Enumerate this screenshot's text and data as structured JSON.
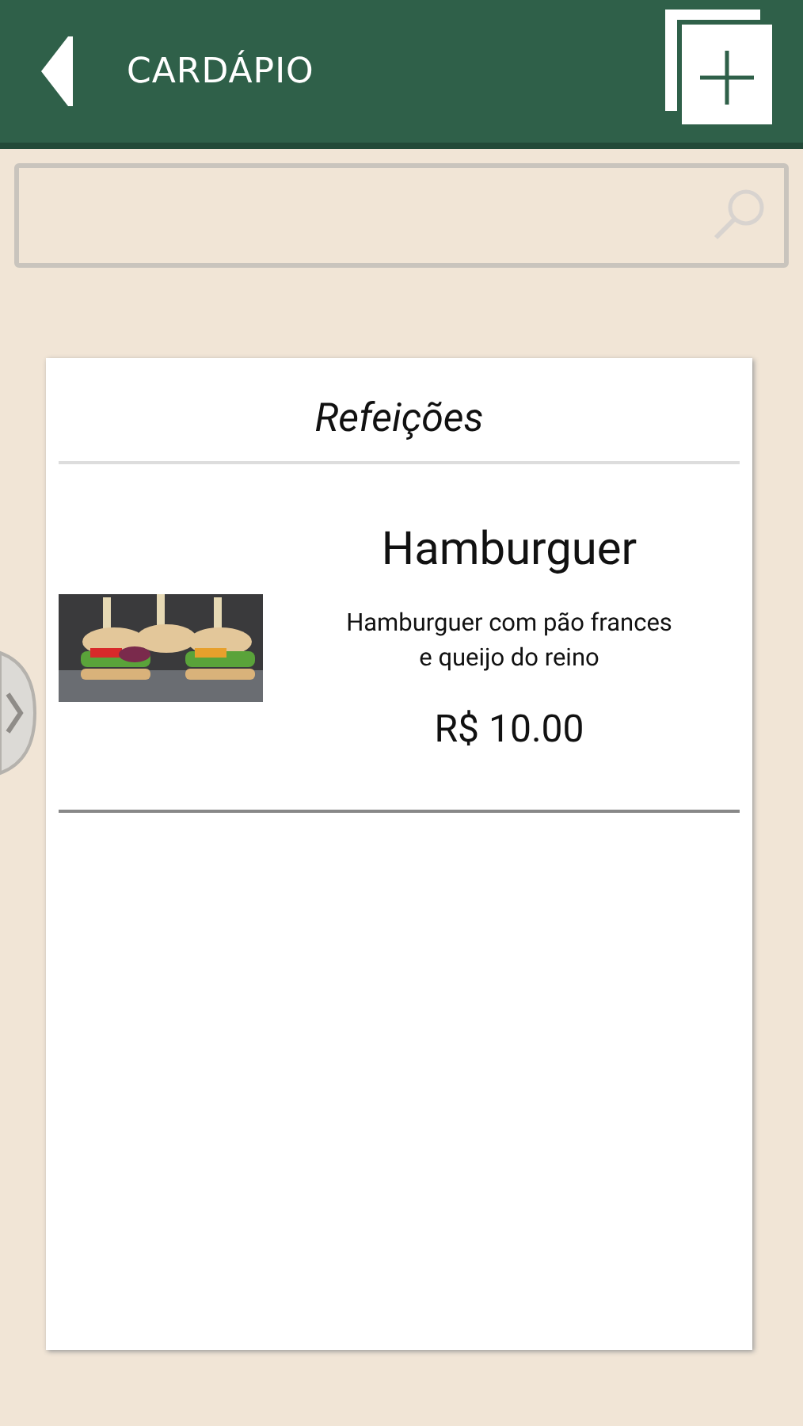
{
  "header": {
    "title": "CARDÁPIO"
  },
  "section": {
    "title": "Refeições"
  },
  "items": [
    {
      "name": "Hamburguer",
      "description": "Hamburguer com pão frances e queijo do reino",
      "price": "R$ 10.00"
    }
  ]
}
